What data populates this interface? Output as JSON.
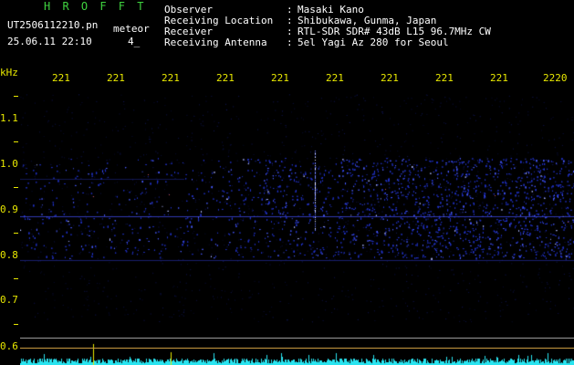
{
  "header": {
    "app_title": "H R O F F T",
    "file_name": "UT2506112210.pn",
    "file_type": "meteor",
    "timestamp": "25.06.11 22:10",
    "counter": "4_"
  },
  "info": {
    "labels": [
      "Observer",
      "Receiving Location",
      "Receiver",
      "Receiving Antenna"
    ],
    "separators": [
      ":",
      ":",
      ":",
      ":"
    ],
    "values": [
      "Masaki Kano",
      "Shibukawa, Gunma, Japan",
      "RTL-SDR SDR# 43dB L15 96.7MHz CW",
      "5el Yagi Az 280 for Seoul"
    ]
  },
  "axis": {
    "y_unit": "kHz",
    "y_ticks": [
      "1.1",
      "1.0",
      "0.9",
      "0.8",
      "0.7",
      "0.6"
    ],
    "x_ticks": [
      "221",
      "221",
      "221",
      "221",
      "221",
      "221",
      "221",
      "221",
      "221",
      "2220"
    ]
  },
  "colors": {
    "accent_yellow": "#e8e800",
    "title_green": "#3fd23f",
    "signal_blue": "#2a3cff",
    "trace_cyan": "#29e4f0"
  }
}
